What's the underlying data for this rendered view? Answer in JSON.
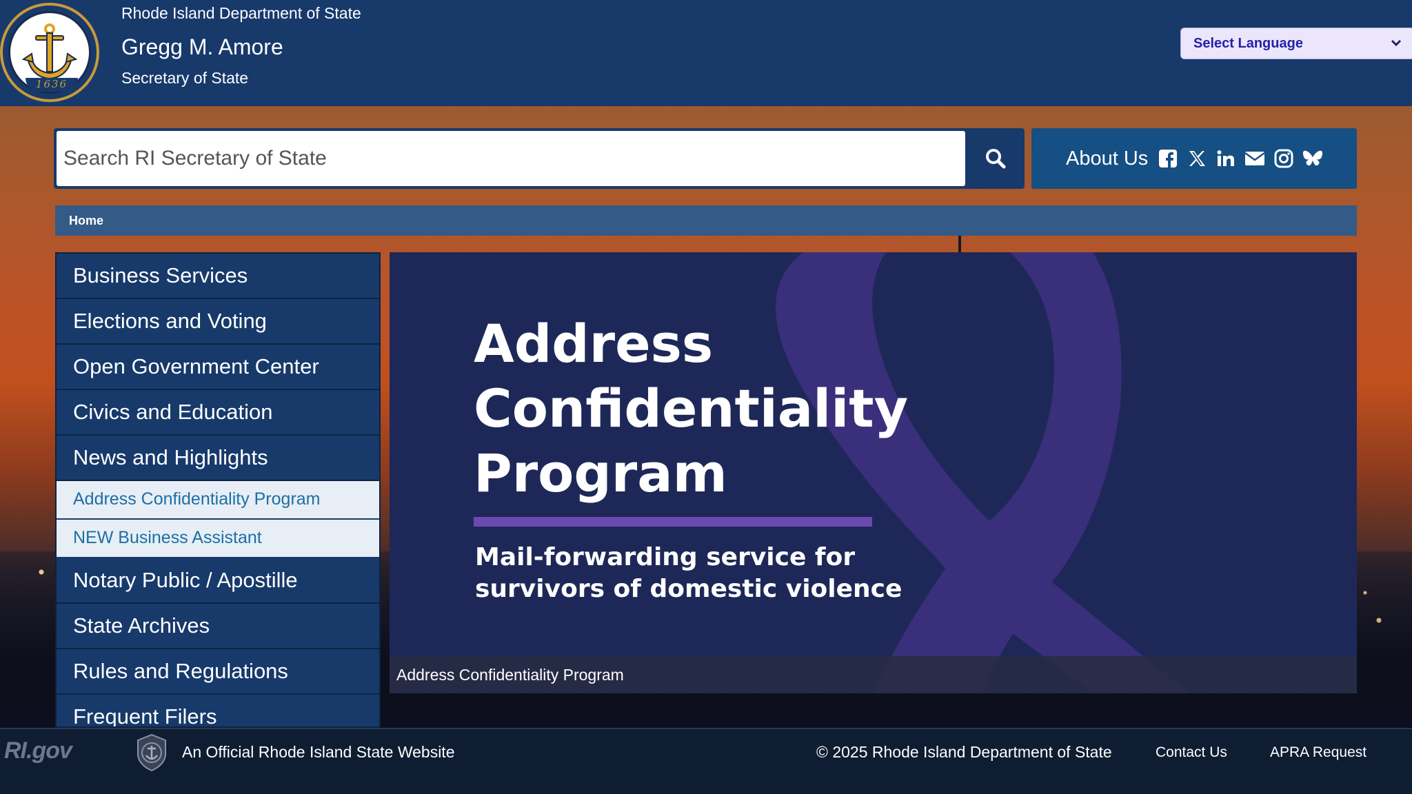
{
  "header": {
    "department": "Rhode Island Department of State",
    "official_name": "Gregg M. Amore",
    "official_title": "Secretary of State",
    "seal_year": "1636",
    "language_select": "Select Language"
  },
  "search": {
    "placeholder": "Search RI Secretary of State"
  },
  "social": {
    "about_label": "About Us",
    "icons": [
      "facebook-icon",
      "x-icon",
      "linkedin-icon",
      "email-icon",
      "instagram-icon",
      "bluesky-icon"
    ]
  },
  "breadcrumb": {
    "home": "Home"
  },
  "sidebar": {
    "items": [
      "Business Services",
      "Elections and Voting",
      "Open Government Center",
      "Civics and Education",
      "News and Highlights"
    ],
    "sub_items": [
      "Address Confidentiality Program",
      "NEW Business Assistant"
    ],
    "items_after": [
      "Notary Public / Apostille",
      "State Archives",
      "Rules and Regulations",
      "Frequent Filers"
    ]
  },
  "hero": {
    "title_lines": [
      "Address",
      "Confidentiality",
      "Program"
    ],
    "subtitle_lines": [
      "Mail-forwarding service for",
      "survivors of domestic violence"
    ],
    "caption": "Address Confidentiality Program"
  },
  "footer": {
    "logo_text": "RI.gov",
    "official_site": "An Official Rhode Island State Website",
    "copyright": "© 2025 Rhode Island Department of State",
    "contact": "Contact Us",
    "apra": "APRA Request"
  },
  "colors": {
    "header_bg": "#173a6b",
    "accent_gold": "#c99a3a",
    "hero_bg": "#1e2858",
    "ribbon_purple": "#3a2f7a",
    "sub_link": "#1c6fa5"
  }
}
